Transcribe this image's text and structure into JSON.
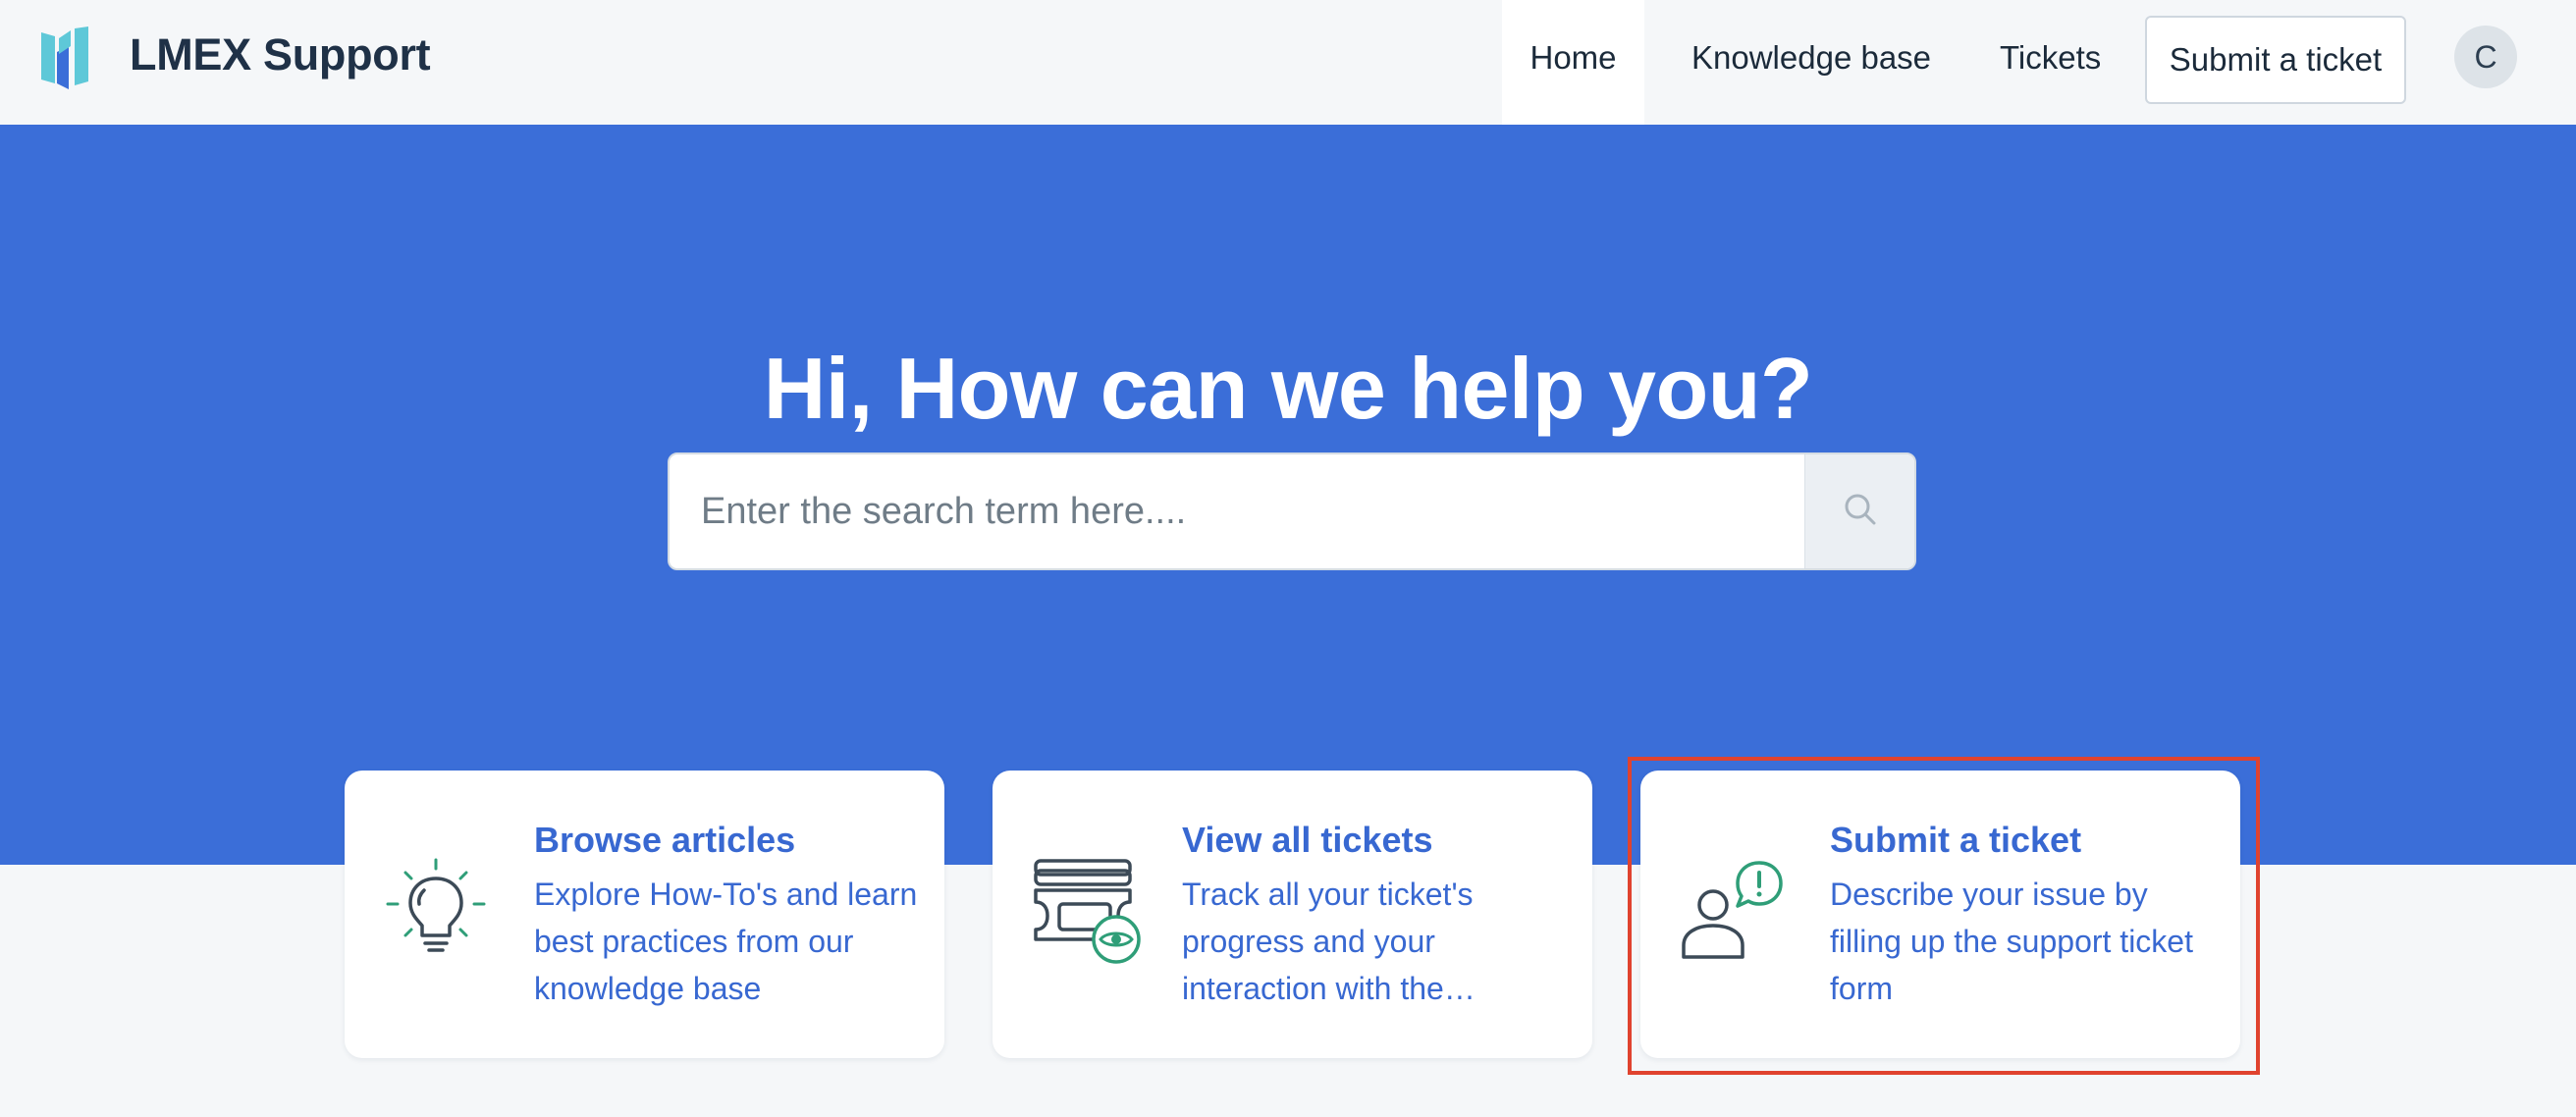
{
  "header": {
    "brand": "LMEX Support",
    "nav": {
      "home": "Home",
      "knowledge_base": "Knowledge base",
      "tickets": "Tickets"
    },
    "submit_button": "Submit a ticket",
    "avatar_initial": "C"
  },
  "hero": {
    "title": "Hi, How can we help you?",
    "search": {
      "placeholder": "Enter the search term here....",
      "value": ""
    }
  },
  "cards": [
    {
      "icon": "lightbulb-icon",
      "title": "Browse articles",
      "description": "Explore How-To's and learn best practices from our knowledge base"
    },
    {
      "icon": "ticket-view-icon",
      "title": "View all tickets",
      "description": "Track all your ticket's progress and your interaction with the…"
    },
    {
      "icon": "person-alert-icon",
      "title": "Submit a ticket",
      "description": "Describe your issue by filling up the support ticket form"
    }
  ],
  "colors": {
    "primary": "#3b6ed8",
    "link": "#3868d1",
    "icon_accent": "#2f9e78",
    "icon_stroke": "#3c4a57",
    "highlight": "#e0432f",
    "background": "#f5f7f9"
  }
}
